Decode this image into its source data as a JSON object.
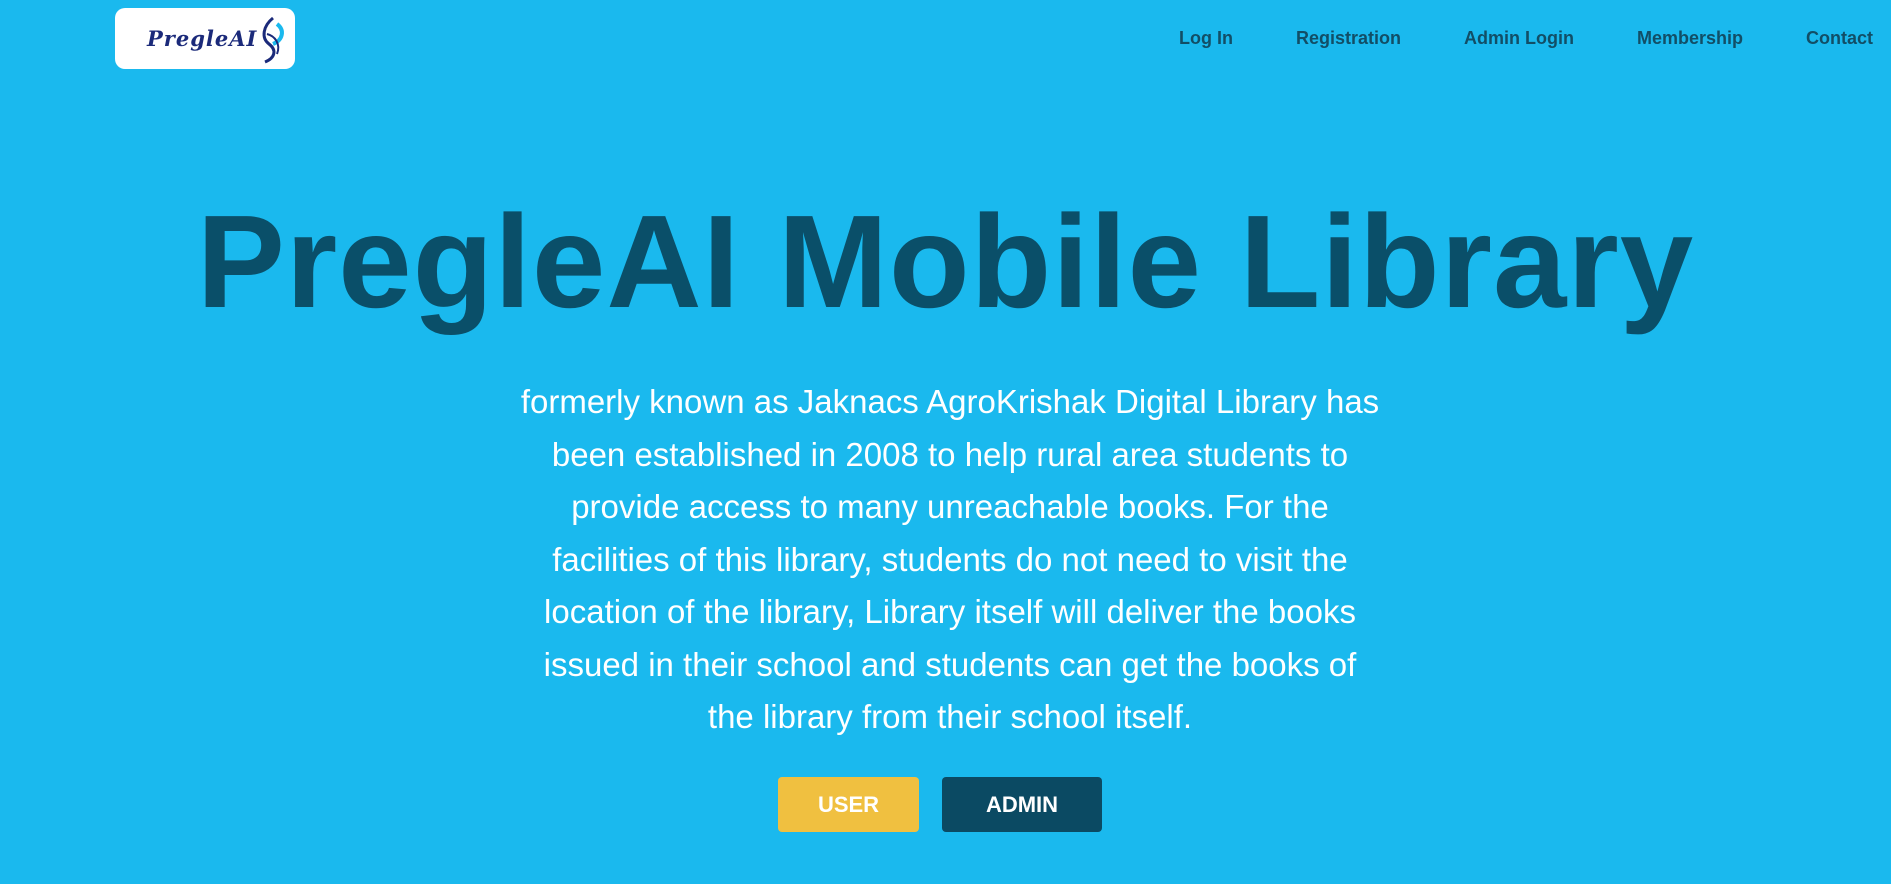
{
  "header": {
    "logo_text": "PregleAI",
    "nav": [
      {
        "label": "Log In"
      },
      {
        "label": "Registration"
      },
      {
        "label": "Admin Login"
      },
      {
        "label": "Membership"
      },
      {
        "label": "Contact"
      }
    ]
  },
  "hero": {
    "title": "PregleAI Mobile Library",
    "description": "formerly known as Jaknacs AgroKrishak Digital Library has been established in 2008 to help rural area students to provide access to many unreachable books. For the facilities of this library, students do not need to visit the location of the library, Library itself will deliver the books issued in their school and students can get the books of the library from their school itself.",
    "buttons": {
      "user": "USER",
      "admin": "ADMIN"
    }
  },
  "colors": {
    "background": "#1ab9ee",
    "title": "#0a4f69",
    "user_button": "#f0c040",
    "admin_button": "#0b4a63"
  },
  "icons": {
    "logo": "pregleai-logo-icon"
  }
}
